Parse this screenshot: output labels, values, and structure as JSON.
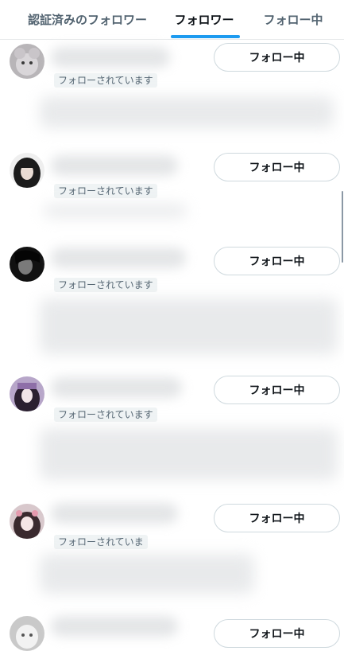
{
  "tabs": [
    {
      "label": "認証済みのフォロワー",
      "active": false
    },
    {
      "label": "フォロワー",
      "active": true
    },
    {
      "label": "フォロー中",
      "active": false
    }
  ],
  "accent_color": "#1d9bf0",
  "rows": [
    {
      "badge": "フォローされています",
      "button": "フォロー中",
      "avatar": "avatar-plush-icon"
    },
    {
      "badge": "フォローされています",
      "button": "フォロー中",
      "avatar": "avatar-dark-hair-icon"
    },
    {
      "badge": "フォローされています",
      "button": "フォロー中",
      "avatar": "avatar-dark-icon"
    },
    {
      "badge": "フォローされています",
      "button": "フォロー中",
      "avatar": "avatar-purple-icon"
    },
    {
      "badge": "フォローされていま",
      "button": "フォロー中",
      "avatar": "avatar-anime-icon"
    },
    {
      "badge": "",
      "button": "フォロー中",
      "avatar": "avatar-white-icon"
    }
  ]
}
